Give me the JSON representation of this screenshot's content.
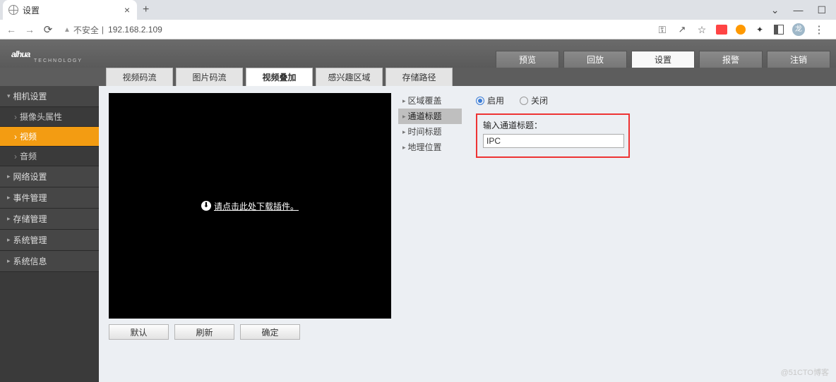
{
  "browser": {
    "tab_title": "设置",
    "insecure_label": "不安全",
    "url": "192.168.2.109",
    "user_initial": "龙"
  },
  "logo": {
    "name": "alhua",
    "sub": "TECHNOLOGY"
  },
  "topnav": {
    "items": [
      "预览",
      "回放",
      "设置",
      "报警",
      "注销"
    ],
    "active_index": 2
  },
  "subtabs": {
    "items": [
      "视频码流",
      "图片码流",
      "视频叠加",
      "感兴趣区域",
      "存储路径"
    ],
    "active_index": 2
  },
  "sidebar": {
    "group1": "相机设置",
    "group1_items": [
      "摄像头属性",
      "视频",
      "音频"
    ],
    "group1_active_index": 1,
    "collapsed_groups": [
      "网络设置",
      "事件管理",
      "存储管理",
      "系统管理",
      "系统信息"
    ]
  },
  "preview": {
    "plugin_prompt": "请点击此处下载插件。",
    "buttons": [
      "默认",
      "刷新",
      "确定"
    ]
  },
  "midcol": {
    "items": [
      "区域覆盖",
      "通道标题",
      "时间标题",
      "地理位置"
    ],
    "active_index": 1
  },
  "form": {
    "radio_on": "启用",
    "radio_off": "关闭",
    "radio_state": "on",
    "input_label": "输入通道标题：",
    "input_value": "IPC"
  },
  "watermark": "@51CTO博客"
}
